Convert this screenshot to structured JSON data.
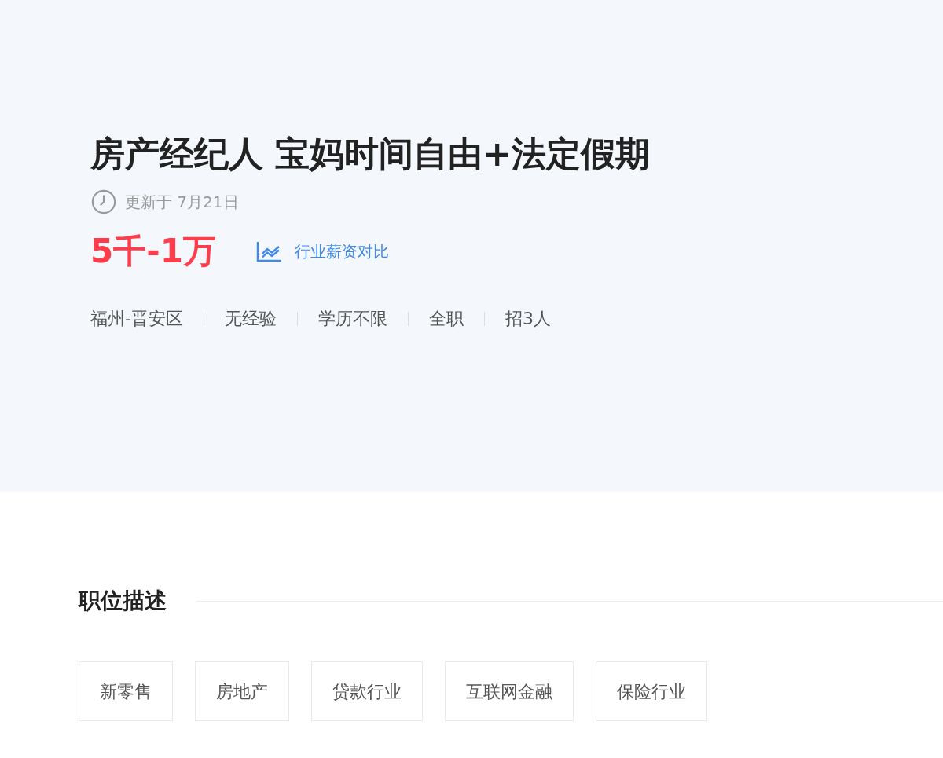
{
  "job": {
    "title": "房产经纪人 宝妈时间自由+法定假期",
    "updated": "更新于 7月21日",
    "salary": "5千-1万",
    "salary_link": "行业薪资对比",
    "meta": [
      "福州-晋安区",
      "无经验",
      "学历不限",
      "全职",
      "招3人"
    ]
  },
  "description": {
    "heading": "职位描述",
    "tags": [
      "新零售",
      "房地产",
      "贷款行业",
      "互联网金融",
      "保险行业"
    ]
  }
}
